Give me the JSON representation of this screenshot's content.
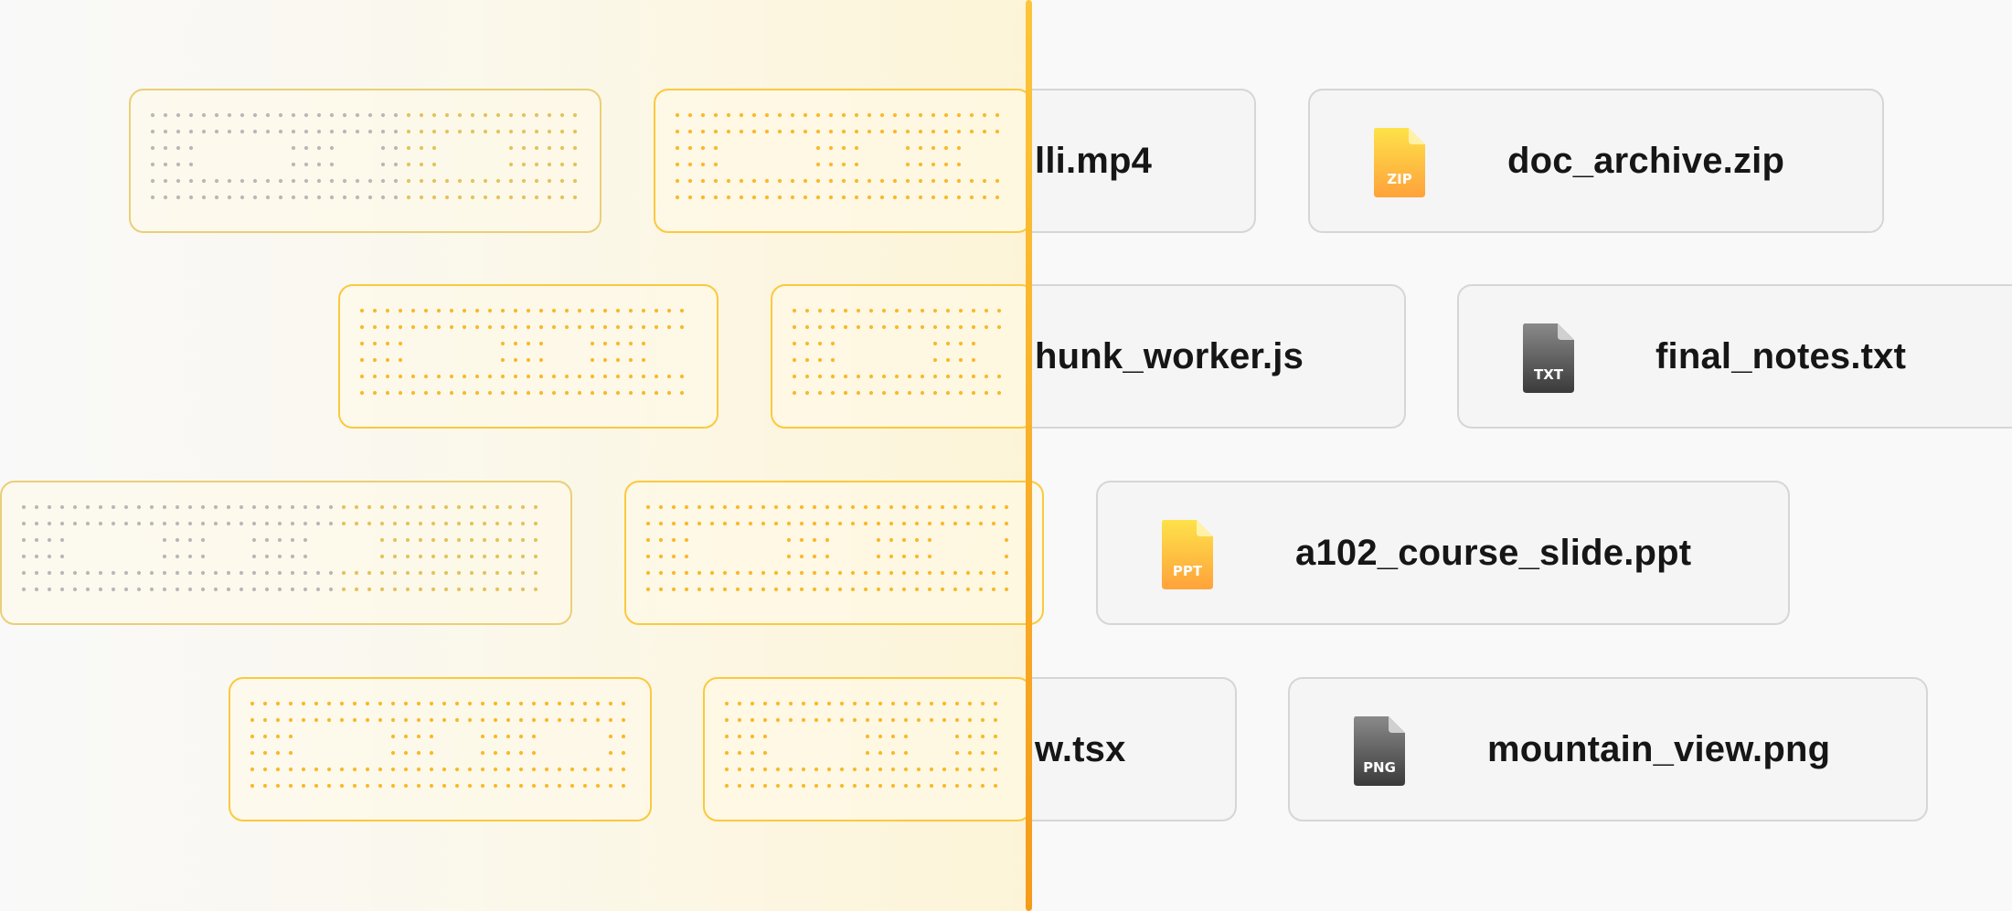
{
  "colors": {
    "accent_yellow": "#fbc93d",
    "accent_orange": "#f59b1a",
    "card_border": "#d6d6d6",
    "card_bg": "#f5f5f5",
    "page_bg": "#f9f9f9"
  },
  "files": [
    {
      "name": "lli.mp4"
    },
    {
      "name": "doc_archive.zip",
      "icon": "zip-file-icon",
      "badge": "ZIP"
    },
    {
      "name": "hunk_worker.js"
    },
    {
      "name": "final_notes.txt",
      "icon": "txt-file-icon",
      "badge": "TXT"
    },
    {
      "name": "a102_course_slide.ppt",
      "icon": "ppt-file-icon",
      "badge": "PPT"
    },
    {
      "name": "w.tsx"
    },
    {
      "name": "mountain_view.png",
      "icon": "png-file-icon",
      "badge": "PNG"
    }
  ]
}
